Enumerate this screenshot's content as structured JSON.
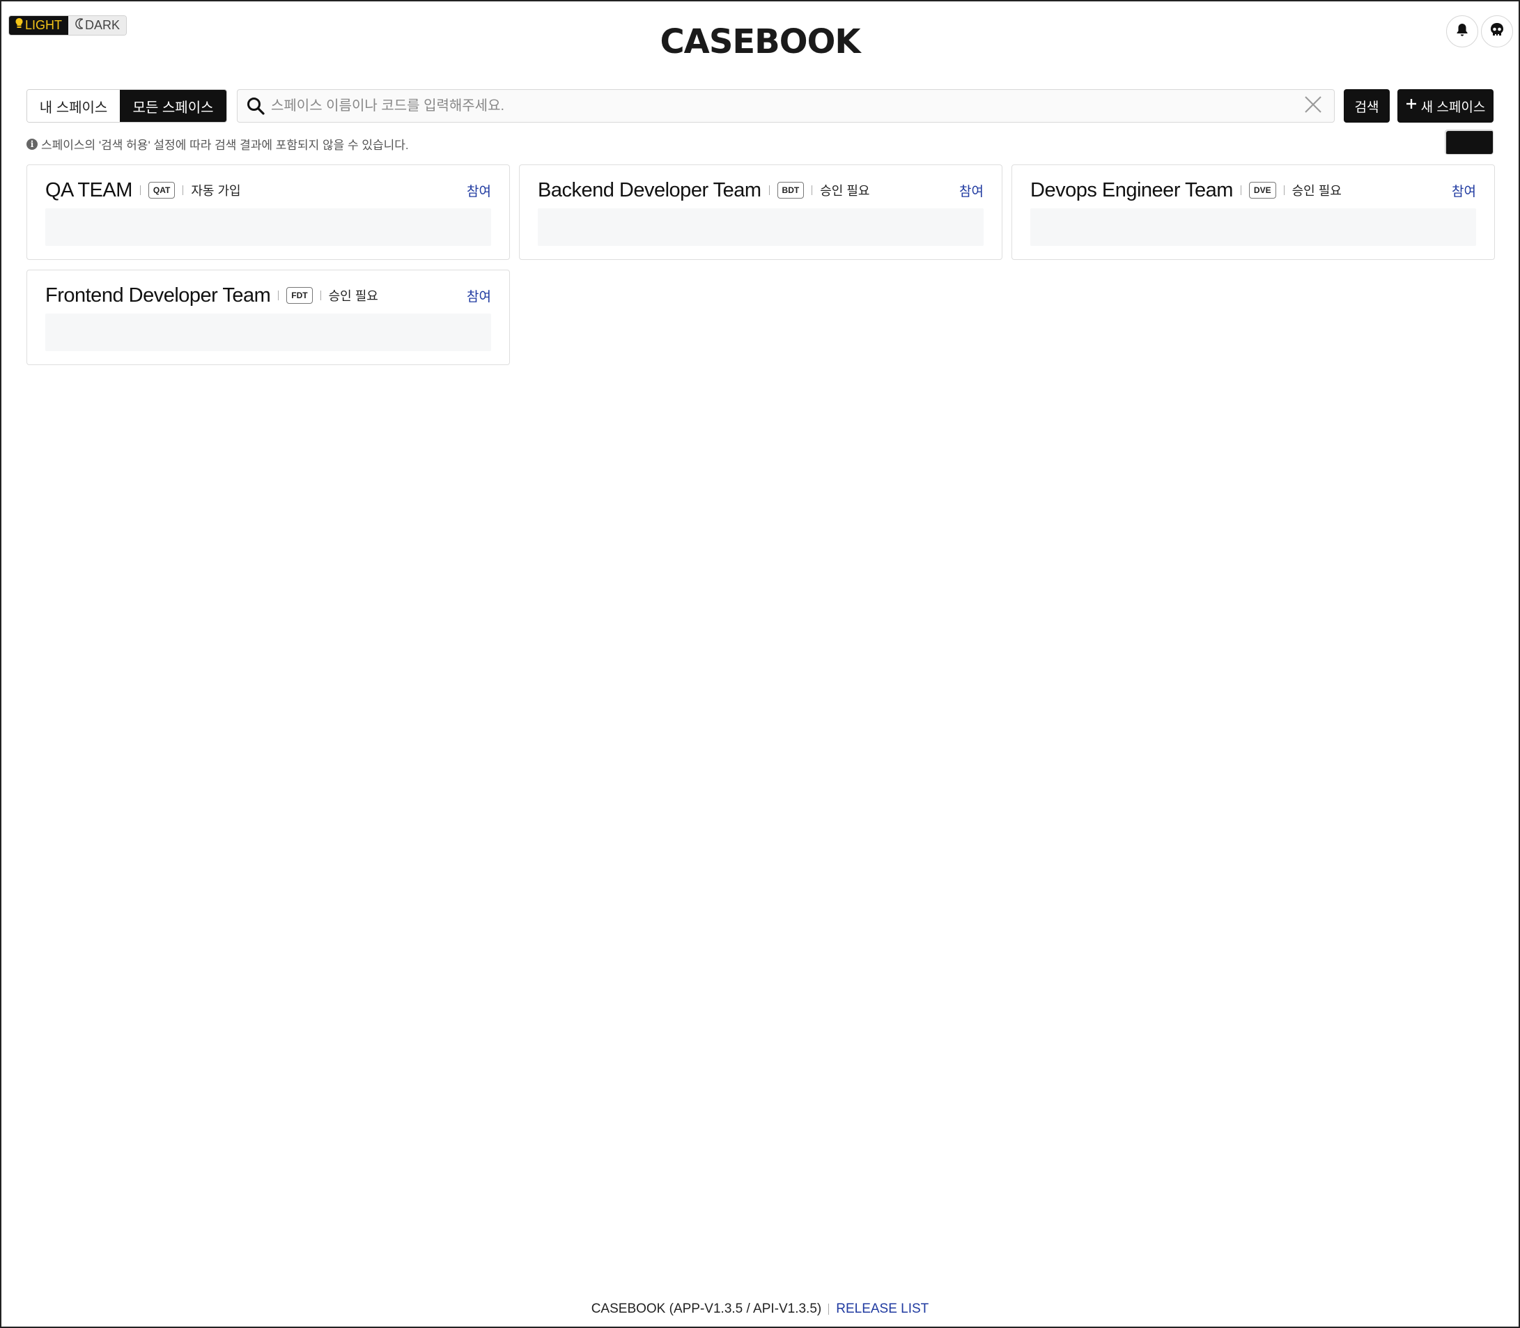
{
  "theme": {
    "light_label": "LIGHT",
    "dark_label": "DARK"
  },
  "header": {
    "logo": "CASEBOOK"
  },
  "toolbar": {
    "tab_mine": "내 스페이스",
    "tab_all": "모든 스페이스",
    "search_placeholder": "스페이스 이름이나 코드를 입력해주세요.",
    "search_value": "",
    "search_button": "검색",
    "new_space_button": "새 스페이스"
  },
  "hint": "스페이스의 '검색 허용' 설정에 따라 검색 결과에 포함되지 않을 수 있습니다.",
  "spaces": [
    {
      "name": "QA TEAM",
      "code": "QAT",
      "join_type": "자동 가입",
      "action": "참여"
    },
    {
      "name": "Backend Developer Team",
      "code": "BDT",
      "join_type": "승인 필요",
      "action": "참여"
    },
    {
      "name": "Devops Engineer Team",
      "code": "DVE",
      "join_type": "승인 필요",
      "action": "참여"
    },
    {
      "name": "Frontend Developer Team",
      "code": "FDT",
      "join_type": "승인 필요",
      "action": "참여"
    }
  ],
  "footer": {
    "version": "CASEBOOK (APP-V1.3.5 / API-V1.3.5)",
    "release_link": "RELEASE LIST"
  },
  "colors": {
    "accent_link": "#1f3aa0",
    "primary": "#111111",
    "light_icon": "#f5c518"
  },
  "icons": [
    "lightbulb-icon",
    "moon-icon",
    "bell-icon",
    "user-avatar-icon",
    "search-icon",
    "close-icon",
    "plus-icon",
    "info-icon",
    "card-view-icon",
    "list-view-icon"
  ]
}
